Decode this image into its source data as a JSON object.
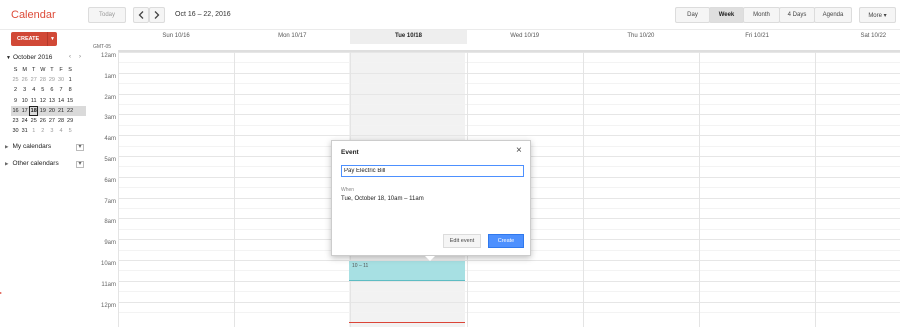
{
  "header": {
    "app_title": "Calendar",
    "today_label": "Today",
    "prev_icon": "chevron-left",
    "next_icon": "chevron-right",
    "date_range": "Oct 16 – 22, 2016",
    "views": [
      "Day",
      "Week",
      "Month",
      "4 Days",
      "Agenda"
    ],
    "active_view": "Week",
    "more_label": "More ▾"
  },
  "sidebar": {
    "create_label": "CREATE",
    "mini_calendar": {
      "month_label": "October 2016",
      "weekday_headers": [
        "S",
        "M",
        "T",
        "W",
        "T",
        "F",
        "S"
      ],
      "weeks": [
        [
          "25",
          "26",
          "27",
          "28",
          "29",
          "30",
          "1"
        ],
        [
          "2",
          "3",
          "4",
          "5",
          "6",
          "7",
          "8"
        ],
        [
          "9",
          "10",
          "11",
          "12",
          "13",
          "14",
          "15"
        ],
        [
          "16",
          "17",
          "18",
          "19",
          "20",
          "21",
          "22"
        ],
        [
          "23",
          "24",
          "25",
          "26",
          "27",
          "28",
          "29"
        ],
        [
          "30",
          "31",
          "1",
          "2",
          "3",
          "4",
          "5"
        ]
      ],
      "current_week_index": 3,
      "today": "18"
    },
    "my_calendars_label": "My calendars",
    "other_calendars_label": "Other calendars"
  },
  "grid": {
    "timezone": "GMT-05",
    "days": [
      {
        "label": "Sun 10/16"
      },
      {
        "label": "Mon 10/17"
      },
      {
        "label": "Tue 10/18"
      },
      {
        "label": "Wed 10/19"
      },
      {
        "label": "Thu 10/20"
      },
      {
        "label": "Fri 10/21"
      },
      {
        "label": "Sat 10/22"
      }
    ],
    "current_day_index": 2,
    "hours": [
      "12am",
      "1am",
      "2am",
      "3am",
      "4am",
      "5am",
      "6am",
      "7am",
      "8am",
      "9am",
      "10am",
      "11am",
      "12pm"
    ],
    "event": {
      "label": "10 – 11"
    }
  },
  "popup": {
    "title": "Event",
    "title_value": "Pay Electric Bill",
    "when_label": "When",
    "when_value": "Tue, October 18, 10am – 11am",
    "edit_label": "Edit event",
    "create_label": "Create"
  }
}
